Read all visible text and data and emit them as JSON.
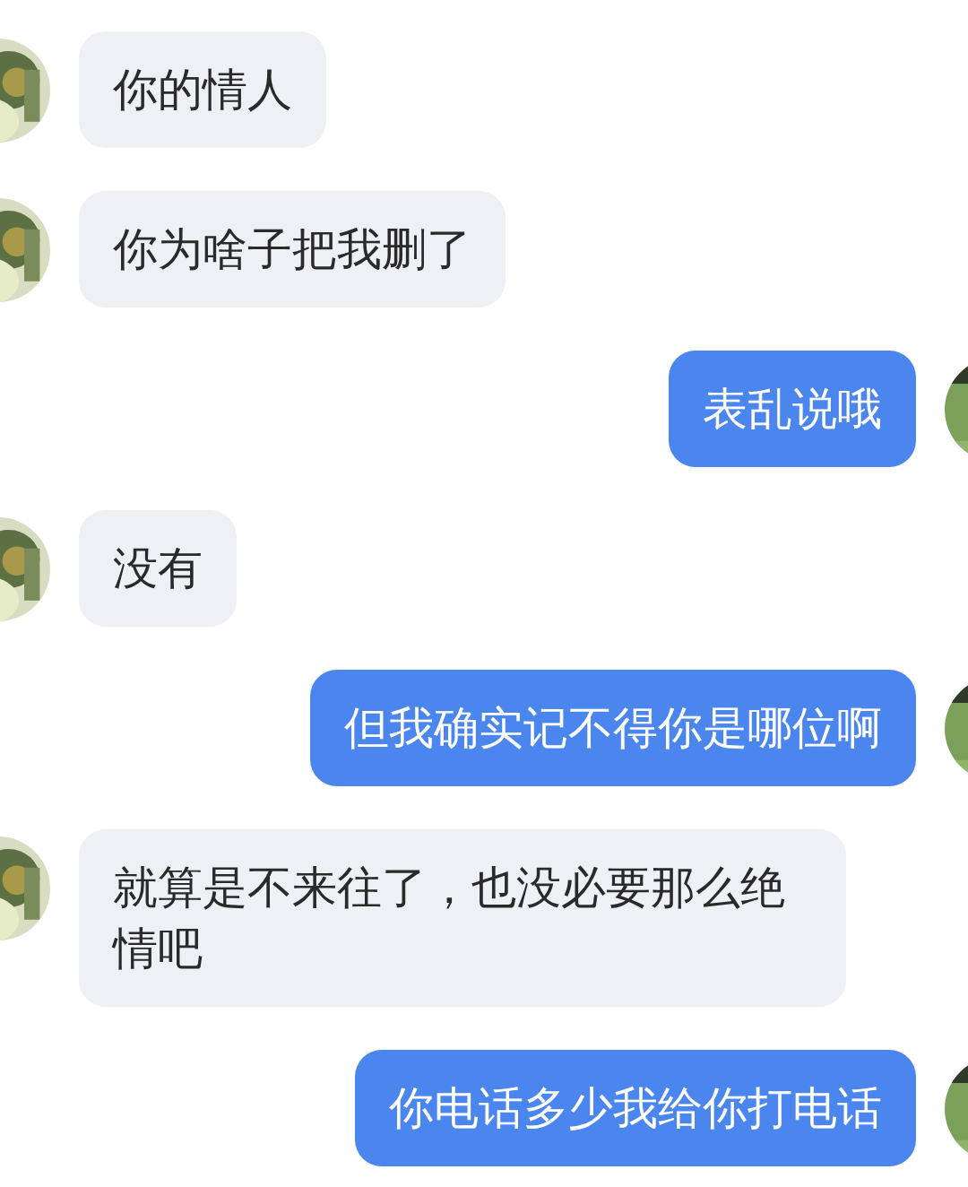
{
  "messages": [
    {
      "kind": "received",
      "text": "你的情人"
    },
    {
      "kind": "received",
      "text": "你为啥子把我删了"
    },
    {
      "kind": "sent",
      "text": "表乱说哦"
    },
    {
      "kind": "received",
      "text": "没有"
    },
    {
      "kind": "sent",
      "text": "但我确实记不得你是哪位啊"
    },
    {
      "kind": "received",
      "text": "就算是不来往了，也没必要那么绝情吧"
    },
    {
      "kind": "sent",
      "text": "你电话多少我给你打电话"
    }
  ]
}
